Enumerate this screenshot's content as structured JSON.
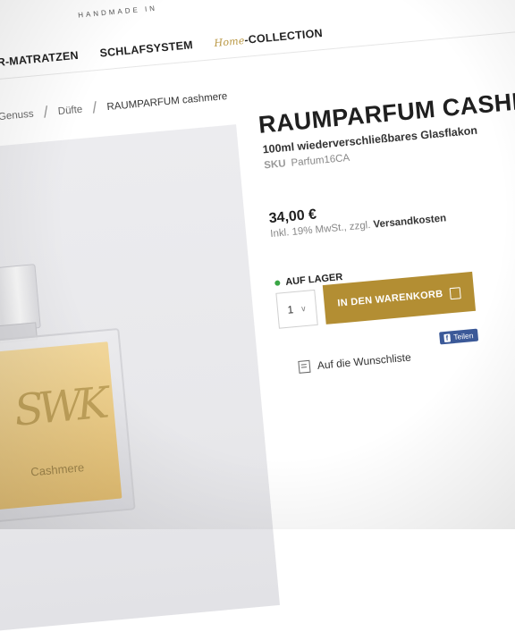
{
  "header": {
    "brand_tagline": "HANDMADE IN",
    "nav": [
      {
        "label": "TUR-MATRATZEN"
      },
      {
        "label": "SCHLAFSYSTEM"
      },
      {
        "label_script": "Home",
        "label": "COLLECTION"
      }
    ]
  },
  "breadcrumb": {
    "items": [
      "& Genuss",
      "Düfte",
      "RAUMPARFUM cashmere"
    ]
  },
  "product": {
    "image": {
      "monogram": "SWK",
      "label": "Cashmere"
    },
    "title": "RAUMPARFUM CASHMERE",
    "subtitle": "100ml wiederverschließbares Glasflakon",
    "sku_label": "SKU",
    "sku_value": "Parfum16CA",
    "price": "34,00 €",
    "price_note": "Inkl. 19% MwSt., zzgl.",
    "price_note_link": "Versandkosten",
    "stock": "AUF LAGER",
    "quantity": "1",
    "add_to_cart": "IN DEN WARENKORB",
    "wishlist": "Auf die Wunschliste",
    "share": "Teilen"
  },
  "colors": {
    "accent": "#b38e33",
    "stock_green": "#3aa645",
    "facebook": "#3b5998"
  }
}
